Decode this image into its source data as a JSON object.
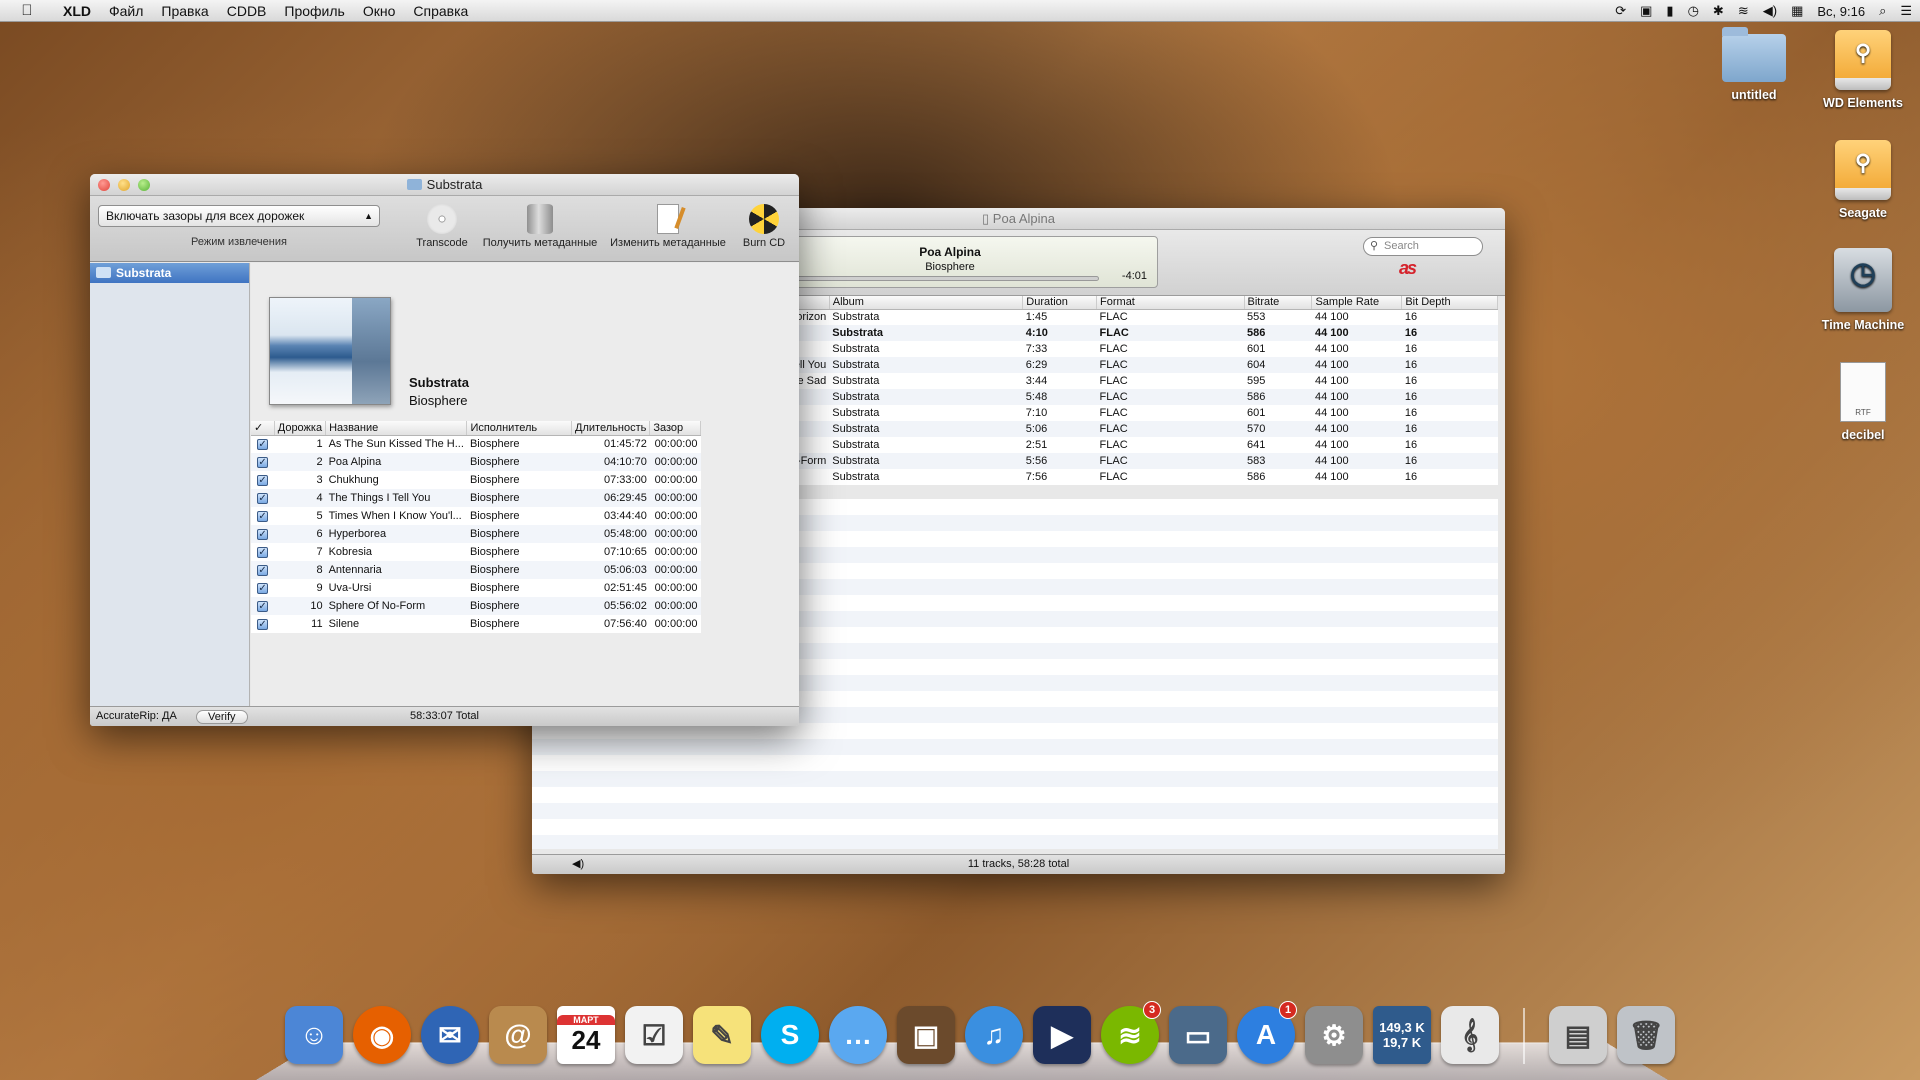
{
  "menubar": {
    "apple_icon": "apple-logo",
    "items": [
      "XLD",
      "Файл",
      "Правка",
      "CDDB",
      "Профиль",
      "Окно",
      "Справка"
    ],
    "clock": "Вс, 9:16",
    "status_icons": [
      "sync-icon",
      "lock-icon",
      "battery-icon",
      "clock-icon",
      "bluetooth-icon",
      "wifi-icon",
      "volume-icon",
      "flag-icon"
    ]
  },
  "desktop": {
    "icons": [
      {
        "label": "untitled",
        "type": "folder"
      },
      {
        "label": "WD Elements",
        "type": "drive"
      },
      {
        "label": "Seagate",
        "type": "drive"
      },
      {
        "label": "Time Machine",
        "type": "time-machine"
      },
      {
        "label": "decibel",
        "type": "rtf",
        "badge": "RTF"
      }
    ]
  },
  "xld": {
    "title": "Substrata",
    "mode_select": "Включать зазоры для всех дорожек",
    "mode_label": "Режим извлечения",
    "toolbar": [
      "Transcode",
      "Получить метаданные",
      "Изменить метаданные",
      "Burn CD"
    ],
    "sidebar_item": "Substrata",
    "album_title": "Substrata",
    "album_artist": "Biosphere",
    "columns": [
      "✓",
      "Дорожка",
      "Название",
      "Исполнитель",
      "Длительность",
      "Зазор"
    ],
    "tracks": [
      {
        "n": "1",
        "title": "As The Sun Kissed The H...",
        "artist": "Biosphere",
        "length": "01:45:72",
        "gap": "00:00:00"
      },
      {
        "n": "2",
        "title": "Poa Alpina",
        "artist": "Biosphere",
        "length": "04:10:70",
        "gap": "00:00:00"
      },
      {
        "n": "3",
        "title": "Chukhung",
        "artist": "Biosphere",
        "length": "07:33:00",
        "gap": "00:00:00"
      },
      {
        "n": "4",
        "title": "The Things I Tell You",
        "artist": "Biosphere",
        "length": "06:29:45",
        "gap": "00:00:00"
      },
      {
        "n": "5",
        "title": "Times When I Know You'l...",
        "artist": "Biosphere",
        "length": "03:44:40",
        "gap": "00:00:00"
      },
      {
        "n": "6",
        "title": "Hyperborea",
        "artist": "Biosphere",
        "length": "05:48:00",
        "gap": "00:00:00"
      },
      {
        "n": "7",
        "title": "Kobresia",
        "artist": "Biosphere",
        "length": "07:10:65",
        "gap": "00:00:00"
      },
      {
        "n": "8",
        "title": "Antennaria",
        "artist": "Biosphere",
        "length": "05:06:03",
        "gap": "00:00:00"
      },
      {
        "n": "9",
        "title": "Uva-Ursi",
        "artist": "Biosphere",
        "length": "02:51:45",
        "gap": "00:00:00"
      },
      {
        "n": "10",
        "title": "Sphere Of No-Form",
        "artist": "Biosphere",
        "length": "05:56:02",
        "gap": "00:00:00"
      },
      {
        "n": "11",
        "title": "Silene",
        "artist": "Biosphere",
        "length": "07:56:40",
        "gap": "00:00:00"
      }
    ],
    "accuraterip": "AccurateRip: ДА",
    "verify": "Verify",
    "total": "58:33:07 Total"
  },
  "player": {
    "title": "Poa Alpina",
    "now_title": "Poa Alpina",
    "now_artist": "Biosphere",
    "remaining": "-4:01",
    "search_placeholder": "Search",
    "lastfm_logo": "as",
    "columns": [
      "",
      "Album",
      "Duration",
      "Format",
      "Bitrate",
      "Sample Rate",
      "Bit Depth"
    ],
    "rows": [
      {
        "name": "ssed The Horizon",
        "album": "Substrata",
        "dur": "1:45",
        "fmt": "FLAC",
        "br": "553",
        "sr": "44 100",
        "bd": "16",
        "bold": false
      },
      {
        "name": "",
        "album": "Substrata",
        "dur": "4:10",
        "fmt": "FLAC",
        "br": "586",
        "sr": "44 100",
        "bd": "16",
        "bold": true
      },
      {
        "name": "",
        "album": "Substrata",
        "dur": "7:33",
        "fmt": "FLAC",
        "br": "601",
        "sr": "44 100",
        "bd": "16",
        "bold": false
      },
      {
        "name": "Tell You",
        "album": "Substrata",
        "dur": "6:29",
        "fmt": "FLAC",
        "br": "604",
        "sr": "44 100",
        "bd": "16",
        "bold": false
      },
      {
        "name": "Know You'll Be Sad",
        "album": "Substrata",
        "dur": "3:44",
        "fmt": "FLAC",
        "br": "595",
        "sr": "44 100",
        "bd": "16",
        "bold": false
      },
      {
        "name": "",
        "album": "Substrata",
        "dur": "5:48",
        "fmt": "FLAC",
        "br": "586",
        "sr": "44 100",
        "bd": "16",
        "bold": false
      },
      {
        "name": "",
        "album": "Substrata",
        "dur": "7:10",
        "fmt": "FLAC",
        "br": "601",
        "sr": "44 100",
        "bd": "16",
        "bold": false
      },
      {
        "name": "",
        "album": "Substrata",
        "dur": "5:06",
        "fmt": "FLAC",
        "br": "570",
        "sr": "44 100",
        "bd": "16",
        "bold": false
      },
      {
        "name": "",
        "album": "Substrata",
        "dur": "2:51",
        "fmt": "FLAC",
        "br": "641",
        "sr": "44 100",
        "bd": "16",
        "bold": false
      },
      {
        "name": "-Form",
        "album": "Substrata",
        "dur": "5:56",
        "fmt": "FLAC",
        "br": "583",
        "sr": "44 100",
        "bd": "16",
        "bold": false
      },
      {
        "name": "",
        "album": "Substrata",
        "dur": "7:56",
        "fmt": "FLAC",
        "br": "586",
        "sr": "44 100",
        "bd": "16",
        "bold": false
      }
    ],
    "status": "11 tracks, 58:28 total"
  },
  "dock": {
    "items": [
      {
        "name": "finder-icon",
        "glyph": "☺",
        "color": "#4c86d6"
      },
      {
        "name": "firefox-icon",
        "glyph": "◉",
        "color": "#e66000"
      },
      {
        "name": "thunderbird-icon",
        "glyph": "✉",
        "color": "#2f65b5"
      },
      {
        "name": "address-book-icon",
        "glyph": "@",
        "color": "#b98a4e"
      },
      {
        "name": "calendar-icon",
        "glyph": "24",
        "month": "МАРТ",
        "color": "#ffffff"
      },
      {
        "name": "reminders-icon",
        "glyph": "☑",
        "color": "#f2f2f2"
      },
      {
        "name": "stickies-icon",
        "glyph": "✎",
        "color": "#f6e27a"
      },
      {
        "name": "skype-icon",
        "glyph": "S",
        "color": "#00aff0"
      },
      {
        "name": "messages-icon",
        "glyph": "…",
        "color": "#5aa8f0"
      },
      {
        "name": "iphoto-icon",
        "glyph": "▣",
        "color": "#6b4a2c"
      },
      {
        "name": "itunes-icon",
        "glyph": "♫",
        "color": "#3a8fe0"
      },
      {
        "name": "quicktime-icon",
        "glyph": "▶",
        "color": "#1e2f5a"
      },
      {
        "name": "spotify-icon",
        "glyph": "≋",
        "color": "#7ab800",
        "badge": "3"
      },
      {
        "name": "screen-sharing-icon",
        "glyph": "▭",
        "color": "#4b6a8a"
      },
      {
        "name": "app-store-icon",
        "glyph": "A",
        "color": "#2d7fe0",
        "badge": "1"
      },
      {
        "name": "system-preferences-icon",
        "glyph": "⚙",
        "color": "#8e8e8e"
      },
      {
        "name": "network-monitor-icon",
        "glyph": "",
        "color": "#2f5b8c",
        "stats": [
          "149,3 K",
          "19,7 K"
        ]
      },
      {
        "name": "music-score-icon",
        "glyph": "𝄞",
        "color": "#e9e9e9"
      },
      {
        "name": "documents-stack-icon",
        "glyph": "▤",
        "color": "#cfcfcf"
      },
      {
        "name": "trash-icon",
        "glyph": "🗑",
        "color": "#bfc3c8"
      }
    ]
  }
}
